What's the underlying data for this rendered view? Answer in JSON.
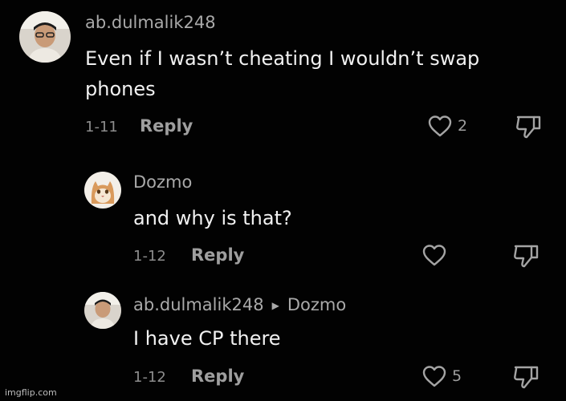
{
  "comments": [
    {
      "username": "ab.dulmalik248",
      "reply_to": "",
      "text": "Even if I wasn’t cheating I wouldn’t swap phones",
      "date": "1-11",
      "reply_label": "Reply",
      "likes": "2"
    },
    {
      "username": "Dozmo",
      "reply_to": "",
      "text": "and why is that?",
      "date": "1-12",
      "reply_label": "Reply",
      "likes": ""
    },
    {
      "username": "ab.dulmalik248",
      "reply_to": "Dozmo",
      "text": "I have CP there",
      "date": "1-12",
      "reply_label": "Reply",
      "likes": "5"
    }
  ],
  "watermark": "imgflip.com",
  "icons": {
    "like": "heart-outline-icon",
    "dislike": "thumbs-down-icon",
    "reply_to": "triangle-right-icon"
  },
  "colors": {
    "background": "#020202",
    "text": "#f1f1f1",
    "secondary": "#9e9e9e"
  }
}
